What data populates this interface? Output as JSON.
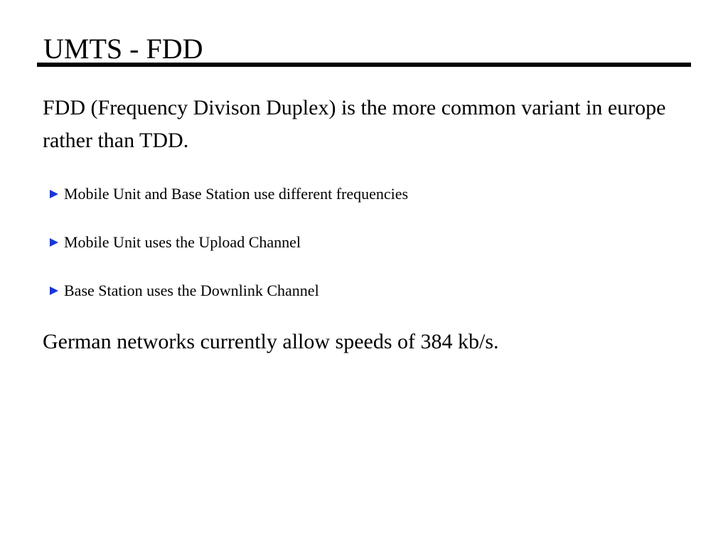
{
  "slide": {
    "title": "UMTS - FDD",
    "intro": "FDD (Frequency Divison Duplex) is the more common variant in europe rather than TDD.",
    "bullets": [
      {
        "text": "Mobile Unit and Base Station use different frequencies",
        "icon": "triangle-bullet-icon"
      },
      {
        "text": "Mobile Unit uses the Upload Channel",
        "icon": "triangle-bullet-icon"
      },
      {
        "text": "Base Station uses the Downlink Channel",
        "icon": "triangle-bullet-icon"
      }
    ],
    "closing": "German networks currently allow speeds of 384 kb/s."
  },
  "colors": {
    "text": "#000000",
    "bullet": "#1a36d6",
    "background": "#ffffff"
  }
}
